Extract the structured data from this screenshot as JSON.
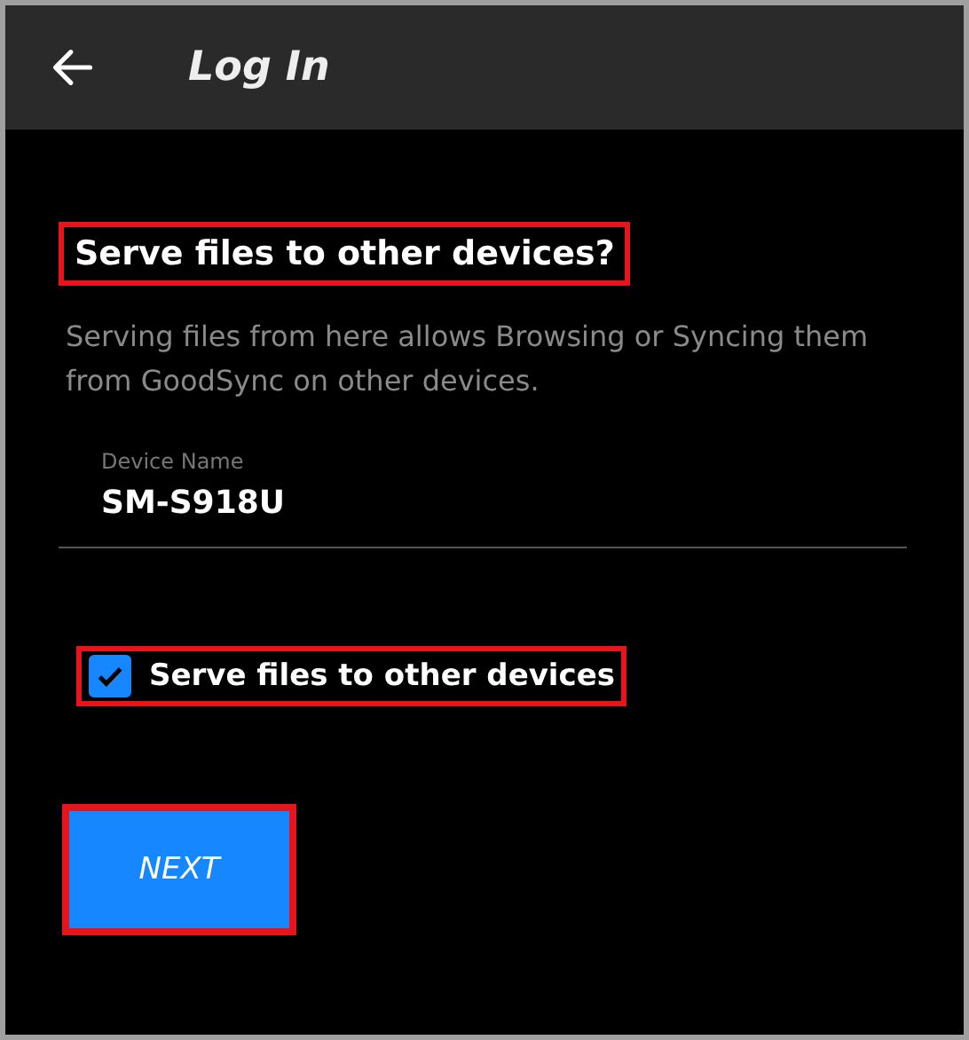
{
  "app_bar": {
    "title": "Log In"
  },
  "heading": {
    "text": "Serve files to other devices?",
    "highlighted": true
  },
  "description": "Serving files from here allows Browsing or Syncing them from GoodSync on other devices.",
  "device_name": {
    "label": "Device Name",
    "value": "SM-S918U"
  },
  "serve_checkbox": {
    "label": "Serve files to other devices",
    "checked": true,
    "highlighted": true
  },
  "next_button": {
    "label": "NEXT",
    "highlighted": true
  }
}
